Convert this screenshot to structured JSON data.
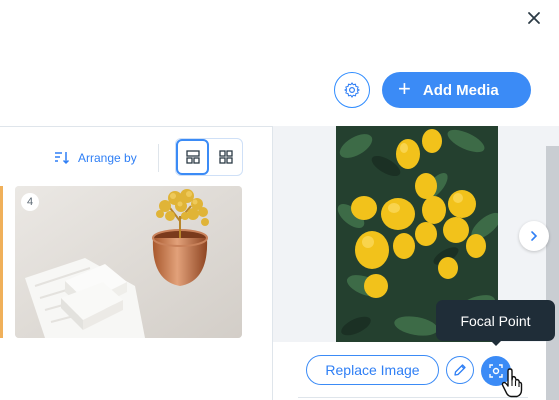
{
  "header": {
    "close_icon": "close-icon",
    "settings_icon": "gear-icon",
    "add_media": {
      "label": "Add Media",
      "icon": "plus-icon"
    }
  },
  "toolbar": {
    "arrange_label": "Arrange by",
    "arrange_icon": "sort-icon",
    "view_options": [
      {
        "name": "large-grid",
        "icon": "grid-large-icon",
        "selected": true
      },
      {
        "name": "small-grid",
        "icon": "grid-small-icon",
        "selected": false
      }
    ]
  },
  "gallery": {
    "items": [
      {
        "index": "4",
        "description": "white soap bars on towel with copper pot and gold bead tree"
      }
    ]
  },
  "preview": {
    "description": "lemon tree with ripe lemons",
    "next_icon": "chevron-right-icon"
  },
  "actions": {
    "replace_label": "Replace Image",
    "edit_icon": "pencil-icon",
    "focal_icon": "focal-point-icon"
  },
  "tooltip": {
    "text": "Focal Point"
  },
  "colors": {
    "accent": "#3b8bf6",
    "tooltip_bg": "#1f2d38",
    "panel_bg": "#f1f3f6"
  }
}
